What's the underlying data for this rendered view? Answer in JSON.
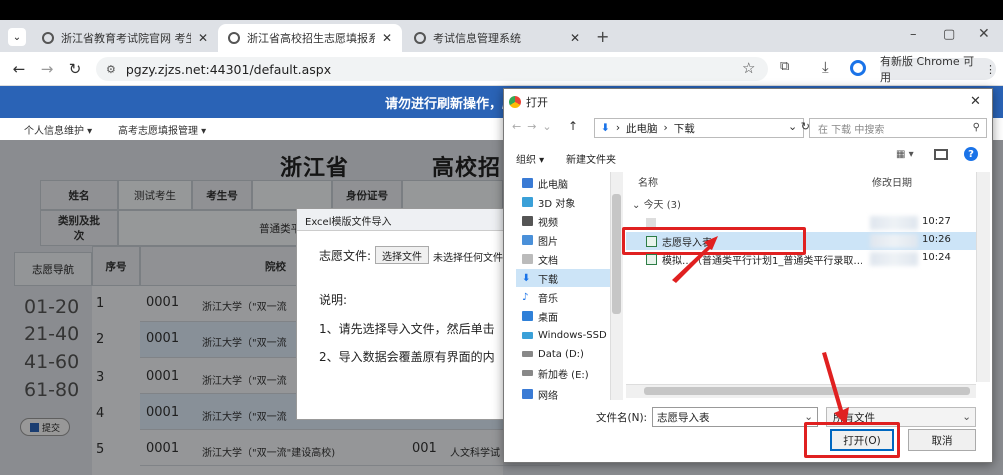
{
  "browser": {
    "tabs": [
      {
        "label": "浙江省教育考试院官网 考生办…",
        "active": false
      },
      {
        "label": "浙江省高校招生志愿填报系统",
        "active": true
      },
      {
        "label": "考试信息管理系统",
        "active": false
      }
    ],
    "new_tab": "+",
    "window_controls": [
      "–",
      "▢",
      "✕"
    ],
    "url": "pgzy.zjzs.net:44301/default.aspx",
    "update_button": "有新版 Chrome 可用"
  },
  "page": {
    "banner": "请勿进行刷新操作，刷",
    "menu": [
      "个人信息维护 ▾",
      "高考志愿填报管理 ▾"
    ],
    "title_left": "浙江省",
    "title_right": "高校招",
    "info": {
      "name_label": "姓名",
      "name_value": "测试考生",
      "exam_no_label": "考生号",
      "id_label": "身份证号",
      "category_label": "类别及批次",
      "category_value": "普通类平行志愿(模拟)"
    },
    "nav": {
      "title": "志愿导航",
      "ranges": [
        "01-20",
        "21-40",
        "41-60",
        "61-80"
      ],
      "submit": "提交"
    },
    "table": {
      "seq_header": "序号",
      "school_header": "院校",
      "rows": [
        {
          "seq": "1",
          "code": "0001",
          "school": "浙江大学（\"双一流"
        },
        {
          "seq": "2",
          "code": "0001",
          "school": "浙江大学（\"双一流"
        },
        {
          "seq": "3",
          "code": "0001",
          "school": "浙江大学（\"双一流"
        },
        {
          "seq": "4",
          "code": "0001",
          "school": "浙江大学（\"双一流"
        },
        {
          "seq": "5",
          "code": "0001",
          "school": "浙江大学（\"双一流\"建设高校)",
          "major_code": "001",
          "major": "人文科学试"
        }
      ]
    }
  },
  "excel_dialog": {
    "title": "Excel模版文件导入",
    "file_label": "志愿文件:",
    "choose_button": "选择文件",
    "no_file": "未选择任何文件",
    "explain_label": "说明:",
    "tip1": "1、请先选择导入文件，然后单击",
    "tip2": "2、导入数据会覆盖原有界面的内"
  },
  "file_dialog": {
    "title": "打开",
    "breadcrumb": [
      "此电脑",
      "下载"
    ],
    "search_placeholder": "在 下载 中搜索",
    "organize": "组织 ▾",
    "new_folder": "新建文件夹",
    "columns": {
      "name": "名称",
      "modified": "修改日期"
    },
    "group": "今天 (3)",
    "sidebar": [
      {
        "label": "此电脑",
        "icon": "pc-icon",
        "color": "#3a7bd5"
      },
      {
        "label": "3D 对象",
        "icon": "cube-icon",
        "color": "#3aa0d8"
      },
      {
        "label": "视频",
        "icon": "video-icon",
        "color": "#555555"
      },
      {
        "label": "图片",
        "icon": "picture-icon",
        "color": "#4a90d9"
      },
      {
        "label": "文档",
        "icon": "document-icon",
        "color": "#777777"
      },
      {
        "label": "下载",
        "icon": "download-icon",
        "color": "#1a73e8"
      },
      {
        "label": "音乐",
        "icon": "music-icon",
        "color": "#1a73e8"
      },
      {
        "label": "桌面",
        "icon": "desktop-icon",
        "color": "#2f80d8"
      },
      {
        "label": "Windows-SSD (",
        "icon": "drive-icon",
        "color": "#3aa0d8"
      },
      {
        "label": "Data (D:)",
        "icon": "drive-icon",
        "color": "#888888"
      },
      {
        "label": "新加卷 (E:)",
        "icon": "drive-icon",
        "color": "#888888"
      },
      {
        "label": "网络",
        "icon": "network-icon",
        "color": "#3a7bd5"
      }
    ],
    "files": [
      {
        "name": "",
        "time": "10:27"
      },
      {
        "name": "志愿导入表",
        "time": "10:26",
        "selected": true
      },
      {
        "name": "模拟…（普通类平行计划1_普通类平行录取…",
        "time": "10:24"
      }
    ],
    "filename_label": "文件名(N):",
    "filename_value": "志愿导入表",
    "filetype": "所有文件",
    "open_button": "打开(O)",
    "cancel_button": "取消"
  },
  "colors": {
    "banner": "#2a63b6",
    "highlight": "#e02020",
    "selected_row": "#cce4f7"
  }
}
